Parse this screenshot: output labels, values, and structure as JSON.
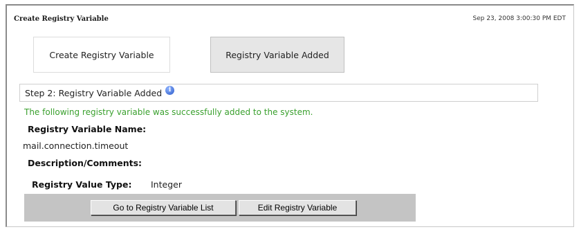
{
  "header": {
    "title": "Create Registry Variable",
    "timestamp": "Sep 23, 2008 3:00:30 PM EDT"
  },
  "wizard": {
    "steps": [
      {
        "label": "Create Registry Variable",
        "active": false
      },
      {
        "label": "Registry Variable Added",
        "active": true
      }
    ]
  },
  "step_header": {
    "text": "Step 2: Registry Variable Added",
    "icon": "info-icon"
  },
  "message": {
    "success": "The following registry variable was successfully added to the system.",
    "color": "#3aa02e"
  },
  "fields": {
    "name_label": "Registry Variable Name:",
    "name_value": "mail.connection.timeout",
    "description_label": "Description/Comments:",
    "description_value": "",
    "type_label": "Registry Value Type:",
    "type_value": "Integer"
  },
  "buttons": {
    "go_to_list": "Go to Registry Variable List",
    "edit": "Edit Registry Variable"
  }
}
